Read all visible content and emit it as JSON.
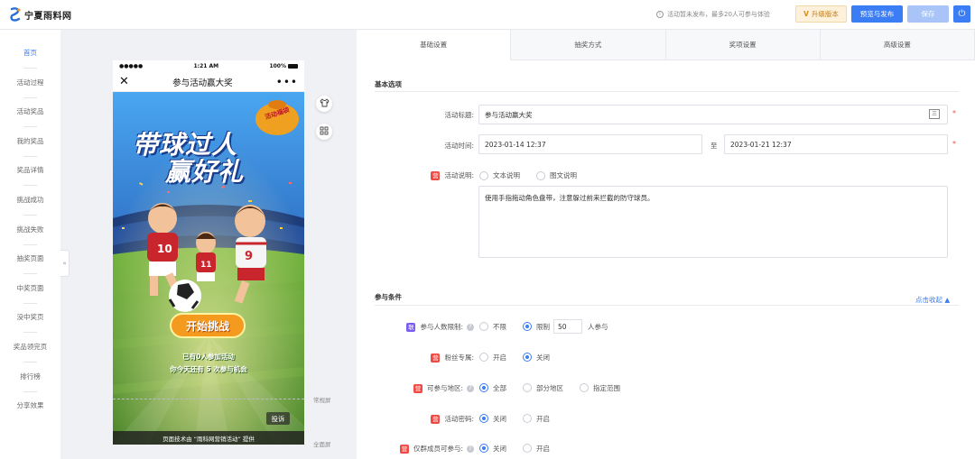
{
  "header": {
    "logo_text": "宁夏雨料网",
    "notice": "活动暂未发布，最多20人可参与体验",
    "upgrade_label": "升级版本",
    "preview_publish_label": "预览与发布",
    "save_label": "保存",
    "colors": {
      "primary": "#3a7df5",
      "upgrade": "#c37a12"
    }
  },
  "sidebar": {
    "items": [
      {
        "label": "首页",
        "active": true
      },
      {
        "label": "活动过程"
      },
      {
        "label": "活动奖品"
      },
      {
        "label": "我的奖品"
      },
      {
        "label": "奖品详情"
      },
      {
        "label": "挑战成功"
      },
      {
        "label": "挑战失败"
      },
      {
        "label": "抽奖页面"
      },
      {
        "label": "中奖页面"
      },
      {
        "label": "没中奖页"
      },
      {
        "label": "奖品领完页"
      },
      {
        "label": "排行榜"
      },
      {
        "label": "分享效果"
      }
    ],
    "collapse_icon": "«"
  },
  "phone": {
    "carrier": "●●●●●",
    "time": "1:21 AM",
    "battery": "100%",
    "close_icon": "✕",
    "title": "参与活动赢大奖",
    "more_icon": "•••",
    "poster": {
      "headline_line1": "带球过人",
      "headline_line2": "赢好礼",
      "bag_label": "活动福袋",
      "start_button": "开始挑战",
      "line1": "已有0人参加活动",
      "line2": "你今天还有 5 次参与机会",
      "report_button": "投诉",
      "footer": "页面技术由 “雨科网营销活动” 提供"
    }
  },
  "preview": {
    "normal_screen_label": "常规屏",
    "full_screen_label": "全面屏",
    "tools": [
      "shirt-icon",
      "grid-icon"
    ]
  },
  "tabs": [
    {
      "label": "基础设置",
      "active": true
    },
    {
      "label": "抽奖方式"
    },
    {
      "label": "奖项设置"
    },
    {
      "label": "高级设置"
    }
  ],
  "basic": {
    "section_title": "基本选项",
    "title_label": "活动标题:",
    "title_value": "参与活动赢大奖",
    "time_label": "活动时间:",
    "start_time": "2023-01-14 12:37",
    "to_label": "至",
    "end_time": "2023-01-21 12:37",
    "desc_badge": "营",
    "desc_label": "活动说明:",
    "desc_option_text": "文本说明",
    "desc_option_rich": "图文说明",
    "desc_value": "使用手指拖动角色盘带，注意躲过前来拦截的防守球员。"
  },
  "conditions": {
    "section_title": "参与条件",
    "collapse_link": "点击收起 ▲",
    "rows": [
      {
        "badge": "联",
        "badge_color": "purple",
        "label": "参与人数限制:",
        "help": true,
        "options": [
          "不限",
          "限制"
        ],
        "selected": 1,
        "count": "50",
        "suffix": "人参与"
      },
      {
        "badge": "营",
        "badge_color": "red",
        "label": "粉丝专属:",
        "help": false,
        "options": [
          "开启",
          "关闭"
        ],
        "selected": 1
      },
      {
        "badge": "营",
        "badge_color": "red",
        "label": "可参与地区:",
        "help": true,
        "options": [
          "全部",
          "部分地区",
          "指定范围"
        ],
        "selected": 0
      },
      {
        "badge": "营",
        "badge_color": "red",
        "label": "活动密码:",
        "help": false,
        "options": [
          "关闭",
          "开启"
        ],
        "selected": 0
      },
      {
        "badge": "营",
        "badge_color": "red",
        "label": "仅群成员可参与:",
        "help": true,
        "options": [
          "关闭",
          "开启"
        ],
        "selected": 0
      }
    ]
  }
}
